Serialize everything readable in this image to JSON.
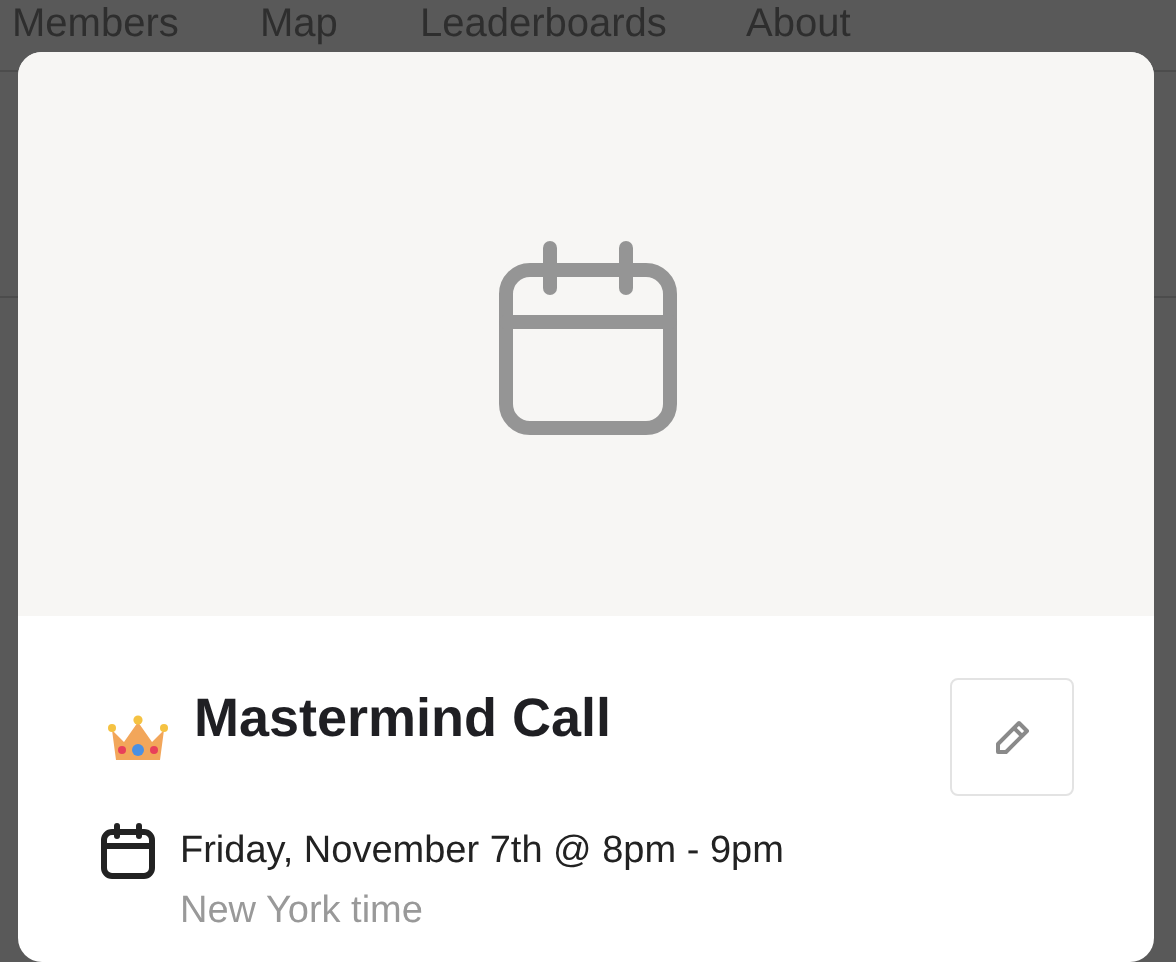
{
  "nav": [
    {
      "label": "Members"
    },
    {
      "label": "Map"
    },
    {
      "label": "Leaderboards"
    },
    {
      "label": "About"
    }
  ],
  "event": {
    "title": "Mastermind Call",
    "date": "Friday, November 7th @ 8pm - 9pm",
    "timezone": "New York time"
  }
}
